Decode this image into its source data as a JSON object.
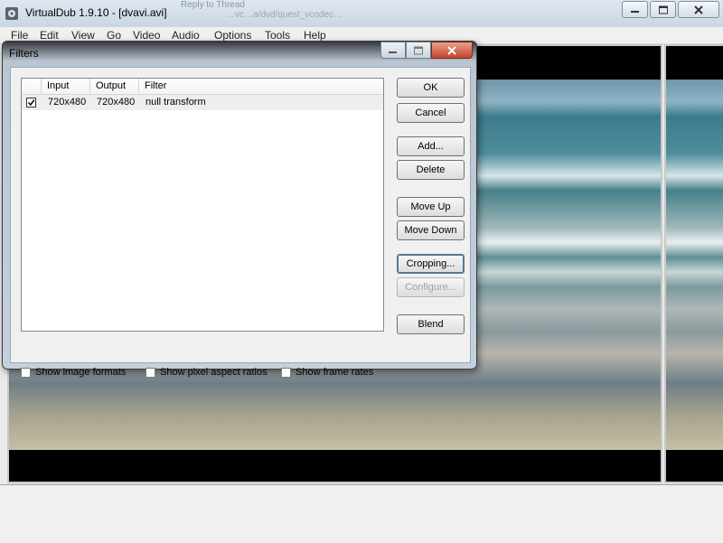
{
  "window": {
    "title": "VirtualDub 1.9.10 - [dvavi.avi]",
    "ghost_text_1": "Reply to Thread",
    "ghost_text_2": "…vc…a/dvd/quest_vcodec…",
    "icons": [
      "virtualdub-icon",
      "minimize-icon",
      "maximize-icon",
      "close-icon"
    ]
  },
  "menu": [
    "File",
    "Edit",
    "View",
    "Go",
    "Video",
    "Audio",
    "Options",
    "Tools",
    "Help"
  ],
  "dialog": {
    "title": "Filters",
    "columns": [
      "Input",
      "Output",
      "Filter"
    ],
    "rows": [
      {
        "checked": true,
        "input": "720x480",
        "output": "720x480",
        "filter": "null transform"
      }
    ],
    "buttons": {
      "ok": "OK",
      "cancel": "Cancel",
      "add": "Add...",
      "delete": "Delete",
      "move_up": "Move Up",
      "move_down": "Move Down",
      "cropping": "Cropping...",
      "configure": "Configure...",
      "blend": "Blend"
    },
    "options": {
      "show_image_formats": "Show image formats",
      "show_pixel_aspect_ratios": "Show pixel aspect ratios",
      "show_frame_rates": "Show frame rates"
    }
  },
  "colors": {
    "accent_close": "#c6432b",
    "titlebar": "#c9d6e3",
    "dialog_frame": "#c4d0dc"
  }
}
